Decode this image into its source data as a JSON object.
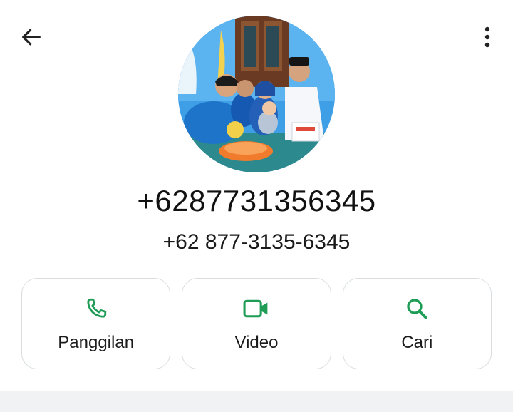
{
  "header": {
    "back_icon": "arrow-left-icon",
    "more_icon": "more-vertical-icon"
  },
  "contact": {
    "name": "+6287731356345",
    "number": "+62 877-3135-6345"
  },
  "actions": [
    {
      "label": "Panggilan",
      "icon": "phone-icon"
    },
    {
      "label": "Video",
      "icon": "video-icon"
    },
    {
      "label": "Cari",
      "icon": "search-icon"
    }
  ],
  "colors": {
    "accent": "#1f9d57",
    "text": "#111111",
    "border": "#d9dde0"
  }
}
